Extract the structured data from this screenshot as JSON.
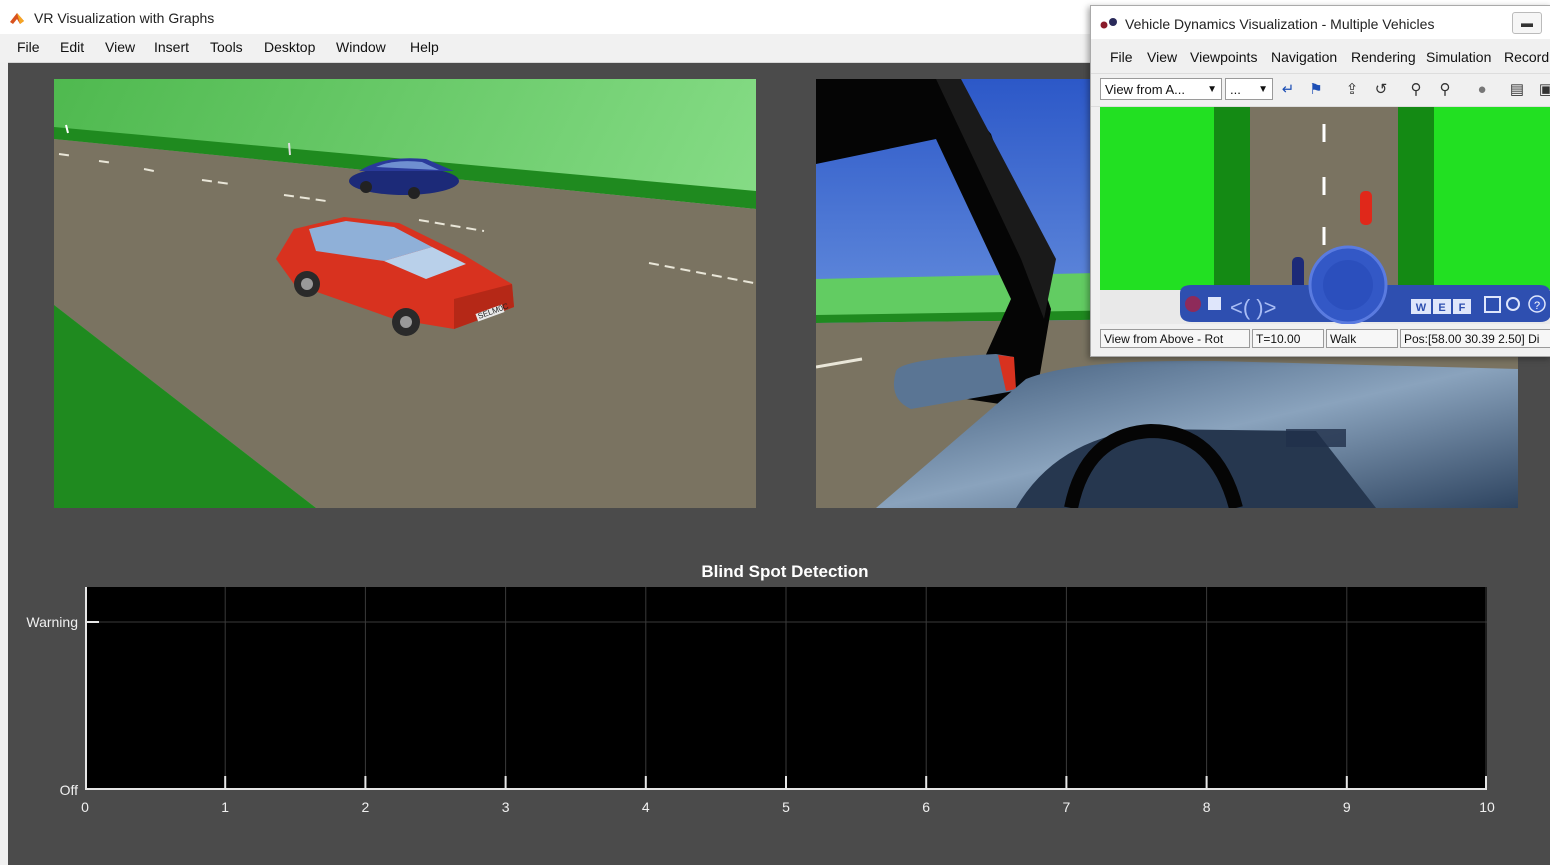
{
  "window": {
    "title": "VR Visualization with Graphs"
  },
  "menu": [
    "File",
    "Edit",
    "View",
    "Insert",
    "Tools",
    "Desktop",
    "Window",
    "Help"
  ],
  "scene_left": {
    "plate_text": "SELM0C"
  },
  "plot": {
    "title": "Blind Spot Detection",
    "y_ticks": [
      "Warning",
      "Off"
    ],
    "x_ticks": [
      "0",
      "1",
      "2",
      "3",
      "4",
      "5",
      "6",
      "7",
      "8",
      "9",
      "10"
    ]
  },
  "chart_data": {
    "type": "line",
    "title": "Blind Spot Detection",
    "xlabel": "",
    "ylabel": "",
    "xlim": [
      0,
      10
    ],
    "y_categories": [
      "Off",
      "Warning"
    ],
    "x_ticks": [
      0,
      1,
      2,
      3,
      4,
      5,
      6,
      7,
      8,
      9,
      10
    ],
    "grid": true,
    "series": []
  },
  "vrml_window": {
    "title": "Vehicle Dynamics Visualization - Multiple Vehicles",
    "menu": [
      "File",
      "View",
      "Viewpoints",
      "Navigation",
      "Rendering",
      "Simulation",
      "Recordi"
    ],
    "viewpoint_select": "View from A...",
    "second_select": "...",
    "nav_buttons": [
      "W",
      "E",
      "F"
    ],
    "status": {
      "viewpoint": "View from Above - Rot",
      "time": "T=10.00",
      "nav_mode": "Walk",
      "position": "Pos:[58.00 30.39 2.50] Di"
    }
  },
  "colors": {
    "background": "#4b4b4b",
    "axes_bg": "#000000",
    "grass": "#1f8a1f",
    "road": "#7a7361",
    "red_car": "#d8321f",
    "blue_car": "#1c2a78",
    "sky": "#3f6fd6"
  }
}
